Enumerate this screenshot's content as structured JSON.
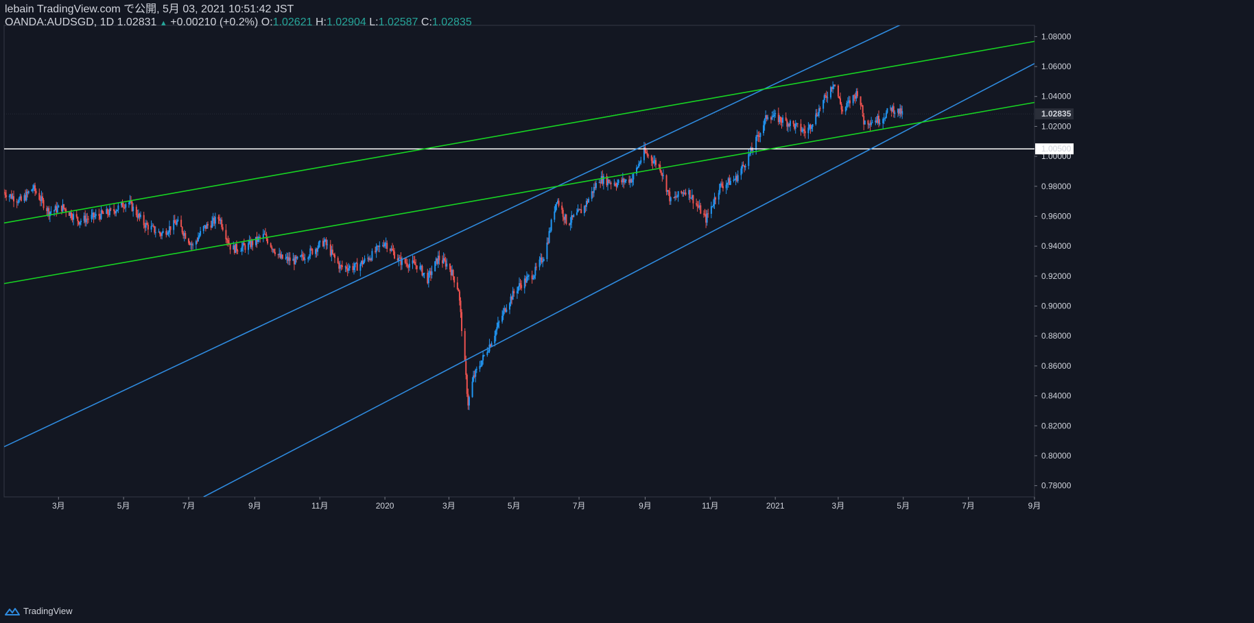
{
  "header": {
    "publish_line": "lebain TradingView.com で公開, 5月 03, 2021 10:51:42 JST",
    "symbol_line": "OANDA:AUDSGD, 1D 1.02831",
    "change": "+0.00210 (+0.2%)",
    "o_label": "O:",
    "o_value": "1.02621",
    "h_label": "H:",
    "h_value": "1.02904",
    "l_label": "L:",
    "l_value": "1.02587",
    "c_label": "C:",
    "c_value": "1.02835"
  },
  "footer": {
    "brand": "TradingView"
  },
  "colors": {
    "background": "#131722",
    "up_candle": "#2196f3",
    "down_candle": "#ef5350",
    "channel_blue": "#2f8bdf",
    "channel_green": "#17d622",
    "level_line": "#ffffff"
  },
  "chart_data": {
    "type": "candlestick",
    "ylim": [
      0.7725,
      1.0875
    ],
    "y_ticks": [
      "0.78000",
      "0.80000",
      "0.82000",
      "0.84000",
      "0.86000",
      "0.88000",
      "0.90000",
      "0.92000",
      "0.94000",
      "0.96000",
      "0.98000",
      "1.00000",
      "1.02000",
      "1.04000",
      "1.06000",
      "1.08000"
    ],
    "x_ticks": [
      {
        "label": "3月",
        "date": "2019-03-01"
      },
      {
        "label": "5月",
        "date": "2019-05-01"
      },
      {
        "label": "7月",
        "date": "2019-07-01"
      },
      {
        "label": "9月",
        "date": "2019-09-01"
      },
      {
        "label": "11月",
        "date": "2019-11-01"
      },
      {
        "label": "2020",
        "date": "2020-01-01"
      },
      {
        "label": "3月",
        "date": "2020-03-01"
      },
      {
        "label": "5月",
        "date": "2020-05-01"
      },
      {
        "label": "7月",
        "date": "2020-07-01"
      },
      {
        "label": "9月",
        "date": "2020-09-01"
      },
      {
        "label": "11月",
        "date": "2020-11-01"
      },
      {
        "label": "2021",
        "date": "2021-01-01"
      },
      {
        "label": "3月",
        "date": "2021-03-01"
      },
      {
        "label": "5月",
        "date": "2021-05-01"
      },
      {
        "label": "7月",
        "date": "2021-07-01"
      },
      {
        "label": "9月",
        "date": "2021-09-01"
      }
    ],
    "x_range": [
      "2019-01-09",
      "2021-09-01"
    ],
    "last_price": {
      "value": 1.02835,
      "label": "1.02835"
    },
    "horizontal_level": {
      "value": 1.005,
      "label": "1.00500"
    },
    "price_path": [
      [
        "2019-01-09",
        0.976
      ],
      [
        "2019-01-25",
        0.97
      ],
      [
        "2019-02-05",
        0.979
      ],
      [
        "2019-02-20",
        0.963
      ],
      [
        "2019-03-05",
        0.966
      ],
      [
        "2019-03-20",
        0.957
      ],
      [
        "2019-04-05",
        0.96
      ],
      [
        "2019-04-20",
        0.963
      ],
      [
        "2019-05-05",
        0.97
      ],
      [
        "2019-05-20",
        0.955
      ],
      [
        "2019-06-05",
        0.948
      ],
      [
        "2019-06-20",
        0.956
      ],
      [
        "2019-07-05",
        0.94
      ],
      [
        "2019-07-15",
        0.952
      ],
      [
        "2019-07-30",
        0.959
      ],
      [
        "2019-08-10",
        0.938
      ],
      [
        "2019-08-25",
        0.94
      ],
      [
        "2019-09-10",
        0.947
      ],
      [
        "2019-09-25",
        0.932
      ],
      [
        "2019-10-10",
        0.93
      ],
      [
        "2019-10-25",
        0.937
      ],
      [
        "2019-11-05",
        0.943
      ],
      [
        "2019-11-20",
        0.926
      ],
      [
        "2019-12-05",
        0.926
      ],
      [
        "2019-12-20",
        0.934
      ],
      [
        "2020-01-01",
        0.943
      ],
      [
        "2020-01-15",
        0.93
      ],
      [
        "2020-02-01",
        0.927
      ],
      [
        "2020-02-10",
        0.918
      ],
      [
        "2020-02-20",
        0.932
      ],
      [
        "2020-03-01",
        0.927
      ],
      [
        "2020-03-10",
        0.911
      ],
      [
        "2020-03-19",
        0.835
      ],
      [
        "2020-03-24",
        0.852
      ],
      [
        "2020-04-10",
        0.877
      ],
      [
        "2020-04-25",
        0.902
      ],
      [
        "2020-05-05",
        0.913
      ],
      [
        "2020-05-20",
        0.922
      ],
      [
        "2020-05-30",
        0.935
      ],
      [
        "2020-06-10",
        0.972
      ],
      [
        "2020-06-20",
        0.955
      ],
      [
        "2020-07-05",
        0.965
      ],
      [
        "2020-07-20",
        0.985
      ],
      [
        "2020-08-05",
        0.982
      ],
      [
        "2020-08-20",
        0.985
      ],
      [
        "2020-08-31",
        1.003
      ],
      [
        "2020-09-15",
        0.993
      ],
      [
        "2020-09-25",
        0.97
      ],
      [
        "2020-10-10",
        0.978
      ],
      [
        "2020-10-28",
        0.958
      ],
      [
        "2020-11-10",
        0.98
      ],
      [
        "2020-11-25",
        0.985
      ],
      [
        "2020-12-10",
        1.004
      ],
      [
        "2020-12-25",
        1.028
      ],
      [
        "2021-01-15",
        1.022
      ],
      [
        "2021-01-30",
        1.016
      ],
      [
        "2021-02-20",
        1.043
      ],
      [
        "2021-02-25",
        1.05
      ],
      [
        "2021-03-05",
        1.03
      ],
      [
        "2021-03-20",
        1.044
      ],
      [
        "2021-03-25",
        1.023
      ],
      [
        "2021-04-10",
        1.025
      ],
      [
        "2021-04-20",
        1.032
      ],
      [
        "2021-05-01",
        1.028
      ]
    ],
    "trend_lines": [
      {
        "color": "blue",
        "from": [
          "2019-01-09",
          0.806
        ],
        "to": [
          "2021-09-01",
          1.13
        ]
      },
      {
        "color": "blue",
        "from": [
          "2019-07-15",
          0.7725
        ],
        "to": [
          "2021-09-01",
          1.062
        ]
      },
      {
        "color": "green",
        "from": [
          "2019-01-09",
          0.9555
        ],
        "to": [
          "2021-09-01",
          1.0768
        ]
      },
      {
        "color": "green",
        "from": [
          "2019-01-09",
          0.915
        ],
        "to": [
          "2021-09-01",
          1.036
        ]
      }
    ]
  }
}
